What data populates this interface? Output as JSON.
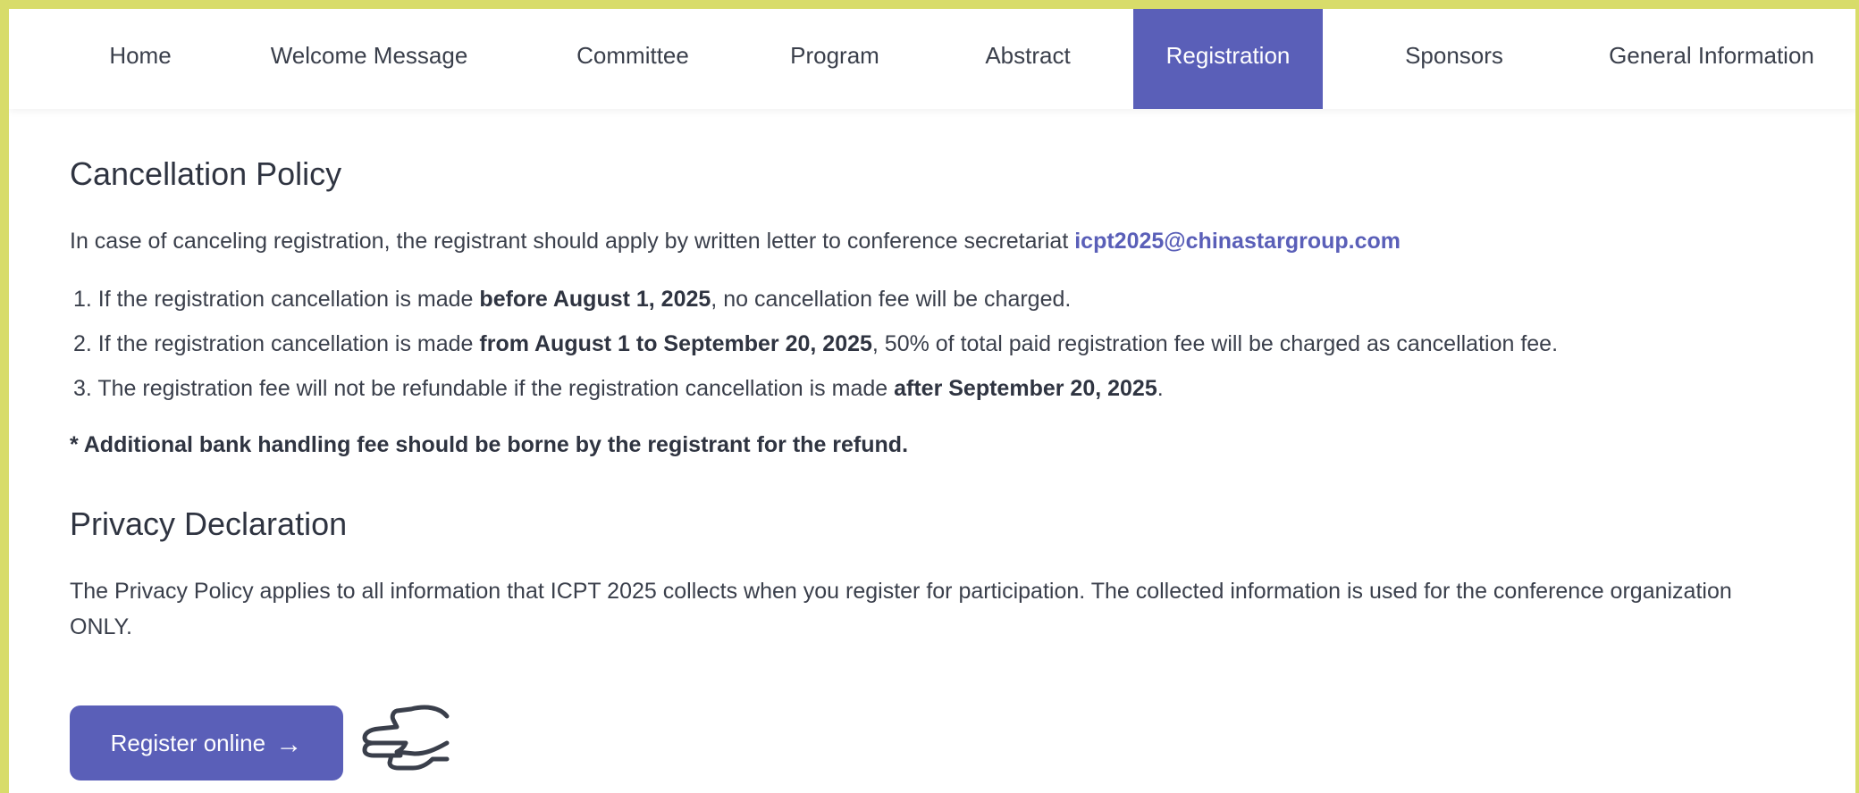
{
  "nav": {
    "items": [
      {
        "label": "Home",
        "active": false
      },
      {
        "label": "Welcome Message",
        "active": false
      },
      {
        "label": "Committee",
        "active": false
      },
      {
        "label": "Program",
        "active": false
      },
      {
        "label": "Abstract",
        "active": false
      },
      {
        "label": "Registration",
        "active": true
      },
      {
        "label": "Sponsors",
        "active": false
      },
      {
        "label": "General Information",
        "active": false
      }
    ]
  },
  "cancellation": {
    "title": "Cancellation Policy",
    "intro": "In case of canceling registration, the registrant should apply by written letter to conference secretariat ",
    "email": "icpt2025@chinastargroup.com",
    "rules": [
      {
        "pre": "If the registration cancellation is made ",
        "bold": "before August 1, 2025",
        "post": ", no cancellation fee will be charged."
      },
      {
        "pre": "If the registration cancellation is made ",
        "bold": "from August 1 to September 20, 2025",
        "post": ", 50% of total paid registration fee will be charged as cancellation fee."
      },
      {
        "pre": "The registration fee will not be refundable if the registration cancellation is made ",
        "bold": "after September 20, 2025",
        "post": "."
      }
    ],
    "note": "* Additional bank handling fee should be borne by the registrant for the refund."
  },
  "privacy": {
    "title": "Privacy Declaration",
    "text": "The Privacy Policy applies to all information that ICPT 2025 collects when you register for participation. The collected information is used for the conference organization ONLY."
  },
  "register": {
    "label": "Register online",
    "arrow": "→"
  },
  "colors": {
    "accent": "#5a5fb8",
    "frame": "#d8dc6a",
    "text": "#3a3f4b"
  },
  "icons": {
    "arrow": "arrow-right-icon",
    "hand": "pointing-hand-icon"
  }
}
